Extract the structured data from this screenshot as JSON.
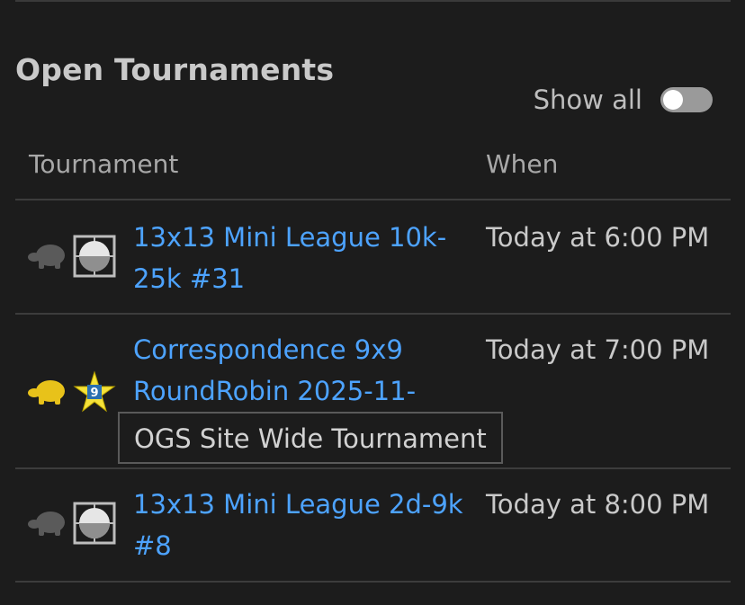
{
  "section": {
    "title": "Open Tournaments",
    "show_all_label": "Show all",
    "show_all_on": false
  },
  "table": {
    "headers": {
      "tournament": "Tournament",
      "when": "When"
    },
    "rows": [
      {
        "name": "13x13 Mini League 10k-25k #31",
        "when": "Today at 6:00 PM",
        "speed_icon": "turtle-icon",
        "speed_color": "#5a5a5a",
        "type_icon": "stone-icon"
      },
      {
        "name": "Correspondence 9x9 RoundRobin 2025-11-",
        "when": "Today at 7:00 PM",
        "speed_icon": "turtle-icon",
        "speed_color": "#e8c21a",
        "type_icon": "star-badge-icon",
        "badge_text": "9"
      },
      {
        "name": "13x13 Mini League 2d-9k #8",
        "when": "Today at 8:00 PM",
        "speed_icon": "turtle-icon",
        "speed_color": "#5a5a5a",
        "type_icon": "stone-icon"
      }
    ]
  },
  "tooltip": {
    "text": "OGS Site Wide Tournament"
  },
  "colors": {
    "background": "#1c1c1c",
    "link": "#4da3ff",
    "text": "#c9c9c9",
    "toggle_off": "#9a9a9a",
    "star": "#f5e23a"
  }
}
